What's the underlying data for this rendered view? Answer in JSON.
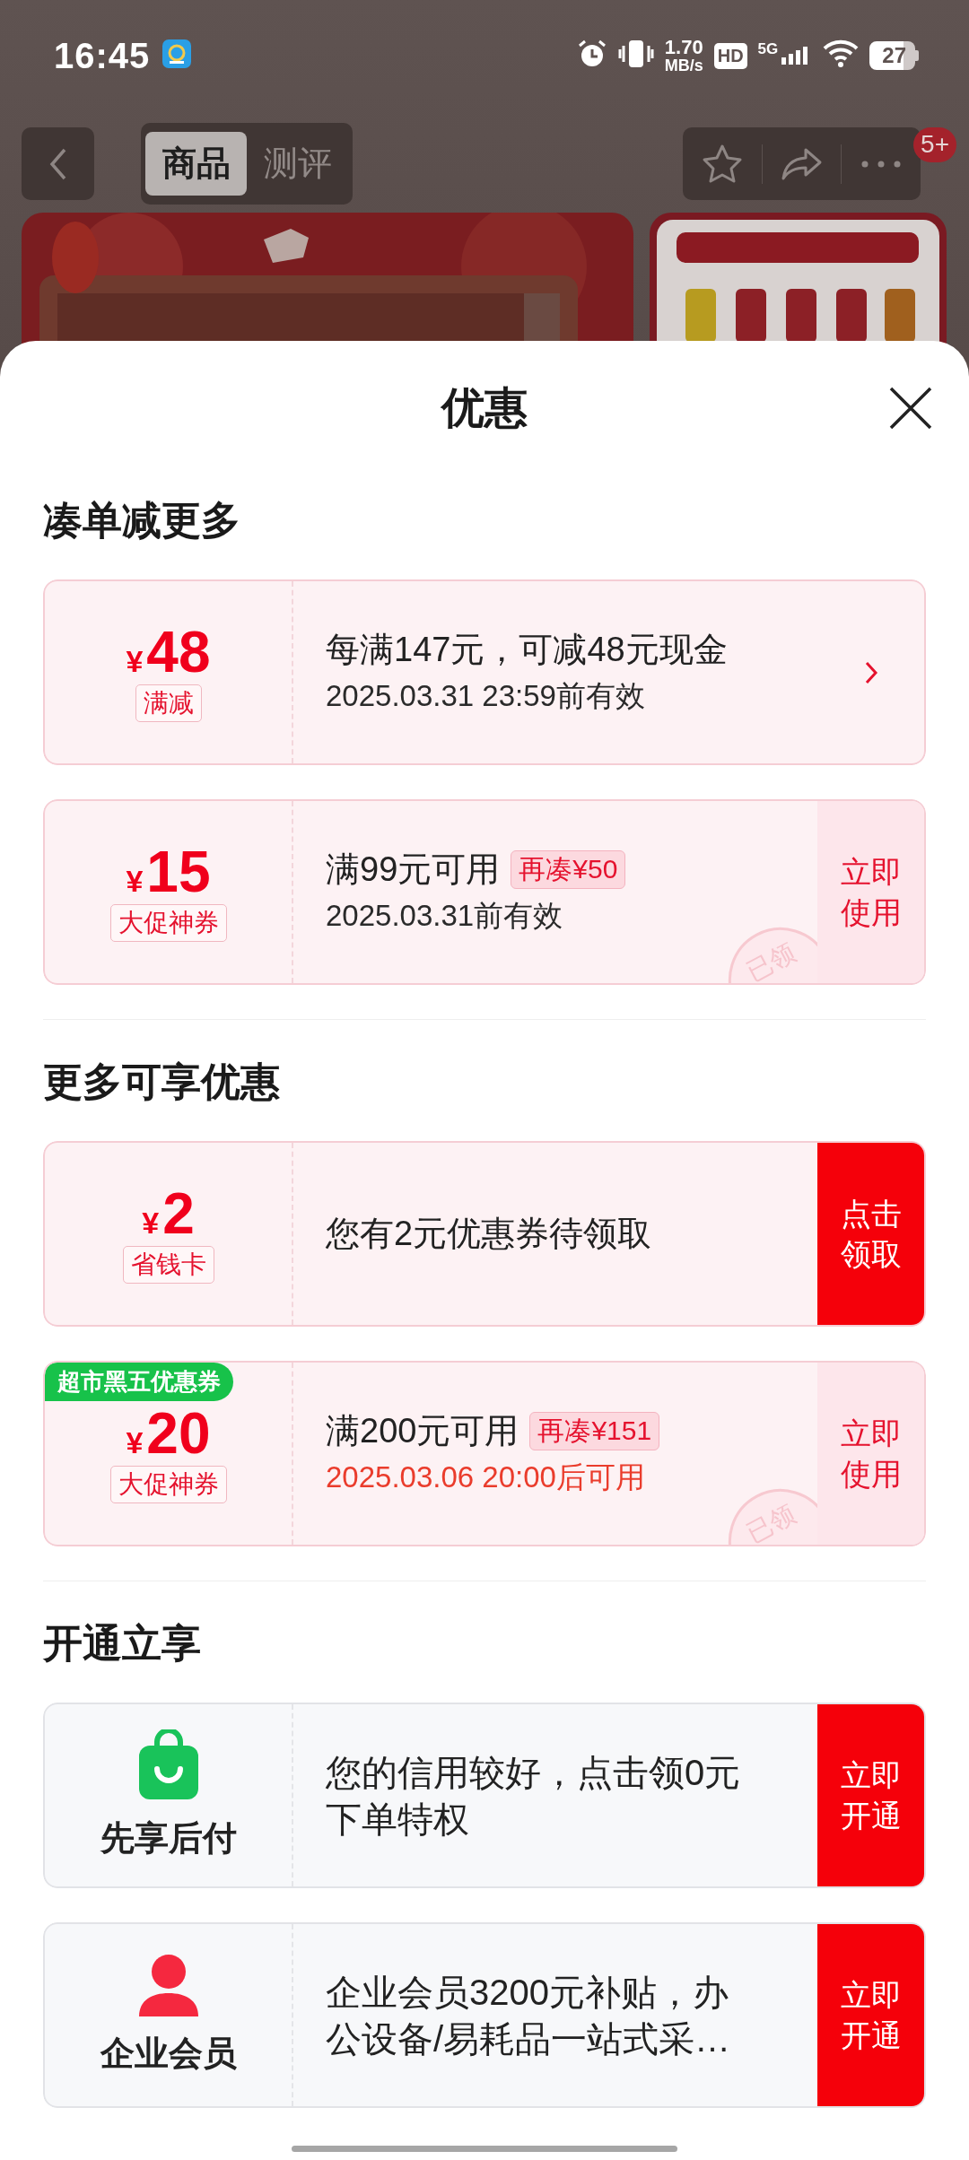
{
  "status_bar": {
    "time": "16:45",
    "speed_value": "1.70",
    "speed_unit": "MB/s",
    "hd": "HD",
    "network": "5G",
    "battery": "27"
  },
  "nav": {
    "tabs": [
      {
        "label": "商品",
        "selected": true
      },
      {
        "label": "测评",
        "selected": false
      }
    ],
    "badge": "5+"
  },
  "sheet": {
    "title": "优惠",
    "sections": [
      {
        "title": "凑单减更多",
        "cards": [
          {
            "kind": "coupon",
            "currency": "¥",
            "amount": "48",
            "tag": "满减",
            "title": "每满147元，可减48元现金",
            "subtitle": "2025.03.31 23:59前有效",
            "subtitle_alert": false,
            "action": {
              "kind": "arrow"
            }
          },
          {
            "kind": "coupon",
            "currency": "¥",
            "amount": "15",
            "tag": "大促神券",
            "title": "满99元可用",
            "extra": "再凑¥50",
            "subtitle": "2025.03.31前有效",
            "subtitle_alert": false,
            "stamp": "已领",
            "action": {
              "kind": "button",
              "label": "立即使用",
              "filled": false
            }
          }
        ]
      },
      {
        "title": "更多可享优惠",
        "cards": [
          {
            "kind": "coupon",
            "currency": "¥",
            "amount": "2",
            "tag": "省钱卡",
            "title": "您有2元优惠券待领取",
            "action": {
              "kind": "button",
              "label": "点击领取",
              "filled": true
            }
          },
          {
            "kind": "coupon",
            "corner": "超市黑五优惠券",
            "currency": "¥",
            "amount": "20",
            "tag": "大促神券",
            "title": "满200元可用",
            "extra": "再凑¥151",
            "subtitle": "2025.03.06 20:00后可用",
            "subtitle_alert": true,
            "stamp": "已领",
            "action": {
              "kind": "button",
              "label": "立即使用",
              "filled": false
            }
          }
        ]
      },
      {
        "title": "开通立享",
        "cards": [
          {
            "kind": "service",
            "name": "先享后付",
            "title": "您的信用较好，点击领0元下单特权",
            "action": {
              "kind": "button",
              "label": "立即开通",
              "filled": true
            }
          },
          {
            "kind": "service",
            "name": "企业会员",
            "title": "企业会员3200元补贴，办公设备/易耗品一站式采…",
            "action": {
              "kind": "button",
              "label": "立即开通",
              "filled": true
            }
          }
        ]
      }
    ]
  }
}
